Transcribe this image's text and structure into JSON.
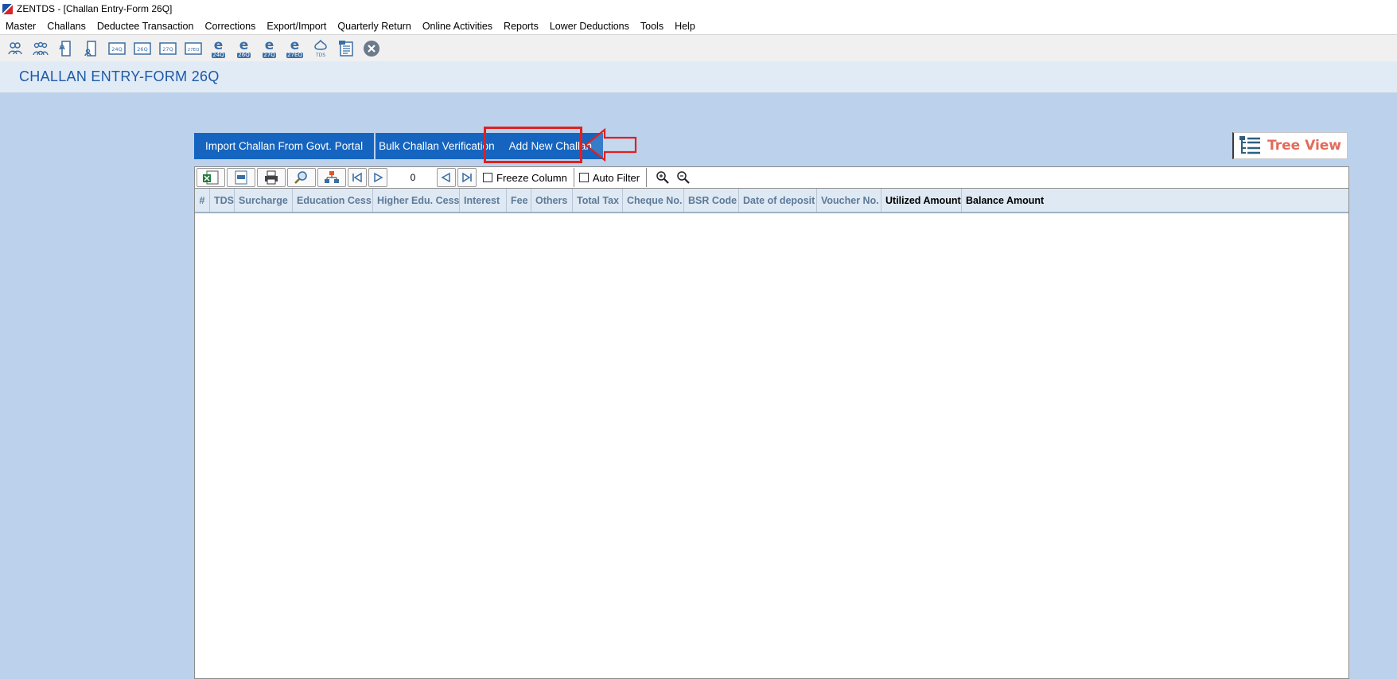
{
  "window": {
    "title": "ZENTDS - [Challan Entry-Form 26Q]"
  },
  "menu": [
    "Master",
    "Challans",
    "Deductee Transaction",
    "Corrections",
    "Export/Import",
    "Quarterly Return",
    "Online Activities",
    "Reports",
    "Lower Deductions",
    "Tools",
    "Help"
  ],
  "toolbar": {
    "form_labels": [
      "24Q",
      "26Q",
      "27Q",
      "27EQ"
    ],
    "e_labels": [
      "24Q",
      "26Q",
      "27Q",
      "27EQ"
    ],
    "tds_label": "TDS"
  },
  "page": {
    "title": "CHALLAN ENTRY-FORM 26Q"
  },
  "actions": {
    "import": "Import Challan From Govt. Portal",
    "bulk": "Bulk Challan Verification",
    "add": "Add New Challan",
    "tree_view": "Tree View"
  },
  "grid": {
    "record_number": "0",
    "freeze_column": "Freeze Column",
    "auto_filter": "Auto Filter",
    "columns": [
      "#",
      "TDS",
      "Surcharge",
      "Education Cess",
      "Higher Edu. Cess",
      "Interest",
      "Fee",
      "Others",
      "Total Tax",
      "Cheque No.",
      "BSR Code",
      "Date of deposit",
      "Voucher No.",
      "Utilized Amount",
      "Balance Amount"
    ]
  },
  "colors": {
    "accent": "#1565c0",
    "highlight": "#e0201f",
    "background": "#bcd2ec"
  }
}
